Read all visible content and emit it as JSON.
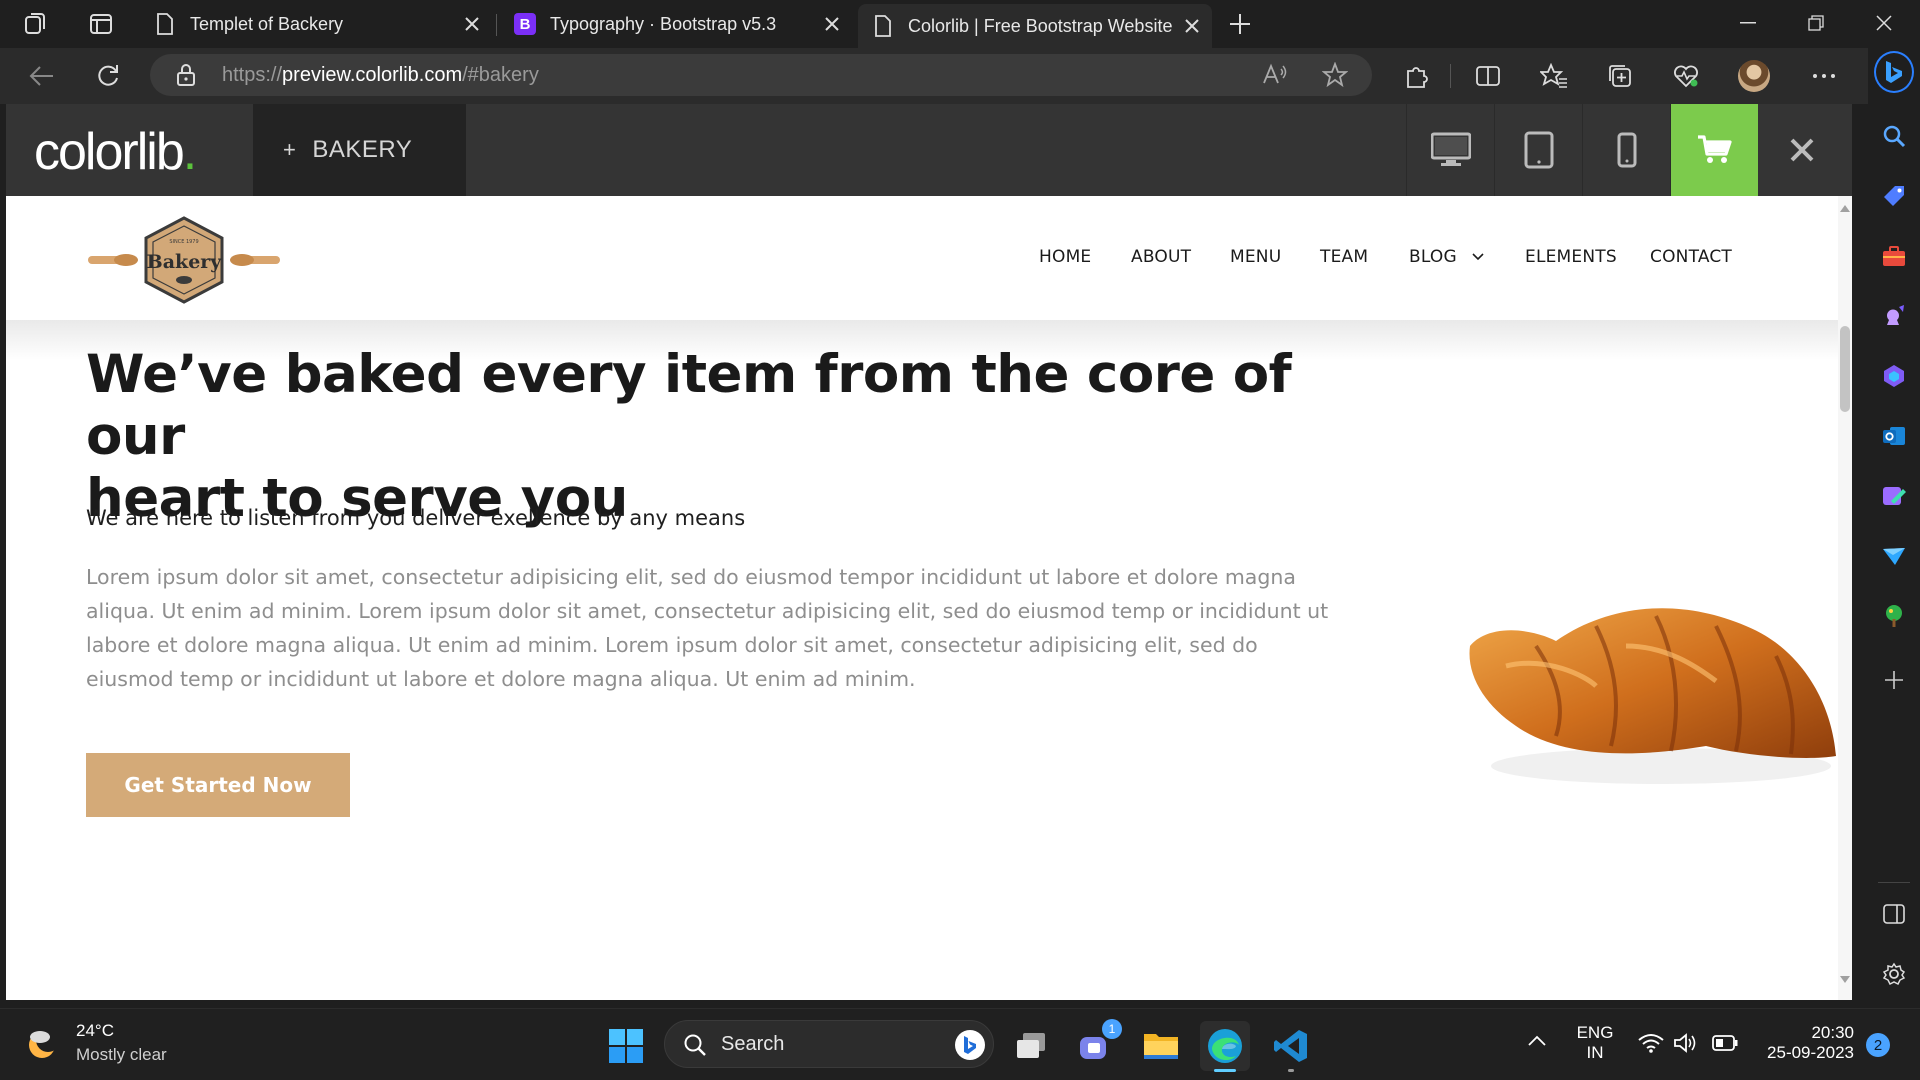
{
  "browser": {
    "tabs": [
      {
        "title": "Templet of Backery",
        "icon": "page-icon",
        "active": false
      },
      {
        "title": "Typography · Bootstrap v5.3",
        "icon": "bootstrap-icon",
        "active": false
      },
      {
        "title": "Colorlib | Free Bootstrap Website",
        "icon": "page-icon",
        "active": true
      }
    ],
    "bootstrap_icon_letter": "B",
    "address": {
      "scheme": "https://",
      "host": "preview.colorlib.com",
      "path": "/#bakery"
    }
  },
  "preview_bar": {
    "logo_text": "colorlib",
    "logo_dot": ".",
    "template_plus": "+",
    "template_name": "BAKERY",
    "accent_color": "#7ccb4c"
  },
  "site": {
    "logo_label": "Bakery",
    "logo_small_text": "SINCE 1979",
    "nav": [
      "HOME",
      "ABOUT",
      "MENU",
      "TEAM",
      "BLOG",
      "ELEMENTS",
      "CONTACT"
    ],
    "hero": {
      "title_line1": "We’ve baked every item from the core of our",
      "title_line2": "heart to serve you",
      "subtitle": "We are here to listen from you deliver exellence by any means",
      "body": "Lorem ipsum dolor sit amet, consectetur adipisicing elit, sed do eiusmod tempor incididunt ut labore et dolore magna aliqua. Ut enim ad minim. Lorem ipsum dolor sit amet, consectetur adipisicing elit, sed do eiusmod temp or incididunt ut labore et dolore magna aliqua. Ut enim ad minim. Lorem ipsum dolor sit amet, consectetur adipisicing elit, sed do eiusmod temp or incididunt ut labore et dolore magna aliqua. Ut enim ad minim.",
      "cta": "Get Started Now",
      "cta_color": "#d4aa78"
    }
  },
  "taskbar": {
    "weather_temp": "24°C",
    "weather_desc": "Mostly clear",
    "search_placeholder": "Search",
    "teams_badge": "1",
    "lang_line1": "ENG",
    "lang_line2": "IN",
    "time": "20:30",
    "date": "25-09-2023",
    "notification_count": "2"
  }
}
